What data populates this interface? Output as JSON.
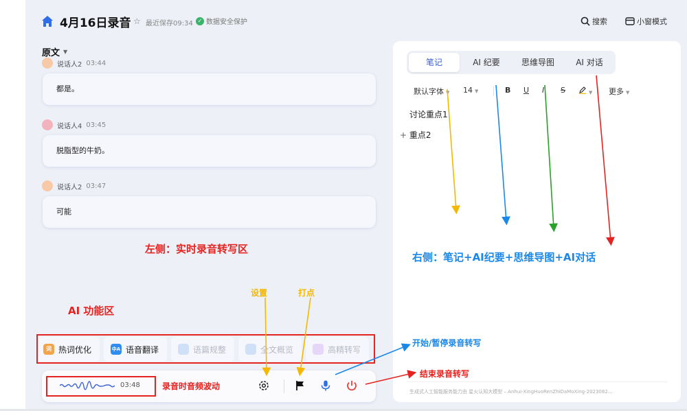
{
  "header": {
    "title": "4月16日录音",
    "save_status": "最近保存09:34",
    "security": "数据安全保护",
    "search_label": "搜索",
    "mini_window_label": "小窗模式"
  },
  "transcript": {
    "section_label": "原文",
    "messages": [
      {
        "speaker": "说话人2",
        "time": "03:44",
        "text": "都是。"
      },
      {
        "speaker": "说话人4",
        "time": "03:45",
        "text": "脱脂型的牛奶。"
      },
      {
        "speaker": "说话人2",
        "time": "03:47",
        "text": "可能"
      }
    ]
  },
  "ai_functions": {
    "items": [
      {
        "label": "热词优化",
        "icon": "词",
        "enabled": true
      },
      {
        "label": "语音翻译",
        "icon": "中A",
        "enabled": true
      },
      {
        "label": "语篇规整",
        "icon": "",
        "enabled": false
      },
      {
        "label": "全文概览",
        "icon": "",
        "enabled": false
      },
      {
        "label": "高精转写",
        "icon": "",
        "enabled": false
      }
    ]
  },
  "recorder": {
    "time": "03:48"
  },
  "right_panel": {
    "tabs": [
      "笔记",
      "AI 纪要",
      "思维导图",
      "AI 对话"
    ],
    "active_tab": 0,
    "toolbar": {
      "font": "默认字体",
      "size": "14",
      "bold": "B",
      "underline": "U",
      "italic": "I",
      "strike": "S",
      "more": "更多"
    },
    "notes": [
      "讨论重点1",
      "重点2"
    ],
    "footer": "生成式人工智能服务能力由 星火认知大模型 – Anhui-XingHuoRenZhiDaMoXing-2023082…"
  },
  "annotations": {
    "left_zone": "左侧：实时录音转写区",
    "right_zone": "右侧：笔记+AI纪要+思维导图+AI对话",
    "ai_zone": "AI 功能区",
    "settings": "设置",
    "mark": "打点",
    "start_pause": "开始/暂停录音转写",
    "stop": "结束录音转写",
    "waveform": "录音时音频波动"
  },
  "colors": {
    "accent": "#3a62d7",
    "annotation_red": "#e52320",
    "annotation_blue": "#1a88e8",
    "annotation_orange": "#f5b800",
    "annotation_green": "#2aa12a",
    "shield_green": "#3bb36b",
    "stop_red": "#e8413b",
    "mic_blue": "#2f6ee8"
  },
  "icons": [
    "home-icon",
    "star-icon",
    "shield-icon",
    "search-icon",
    "mini-window-icon",
    "chevron-down-icon",
    "gear-icon",
    "flag-icon",
    "mic-icon",
    "power-icon",
    "plus-icon"
  ]
}
